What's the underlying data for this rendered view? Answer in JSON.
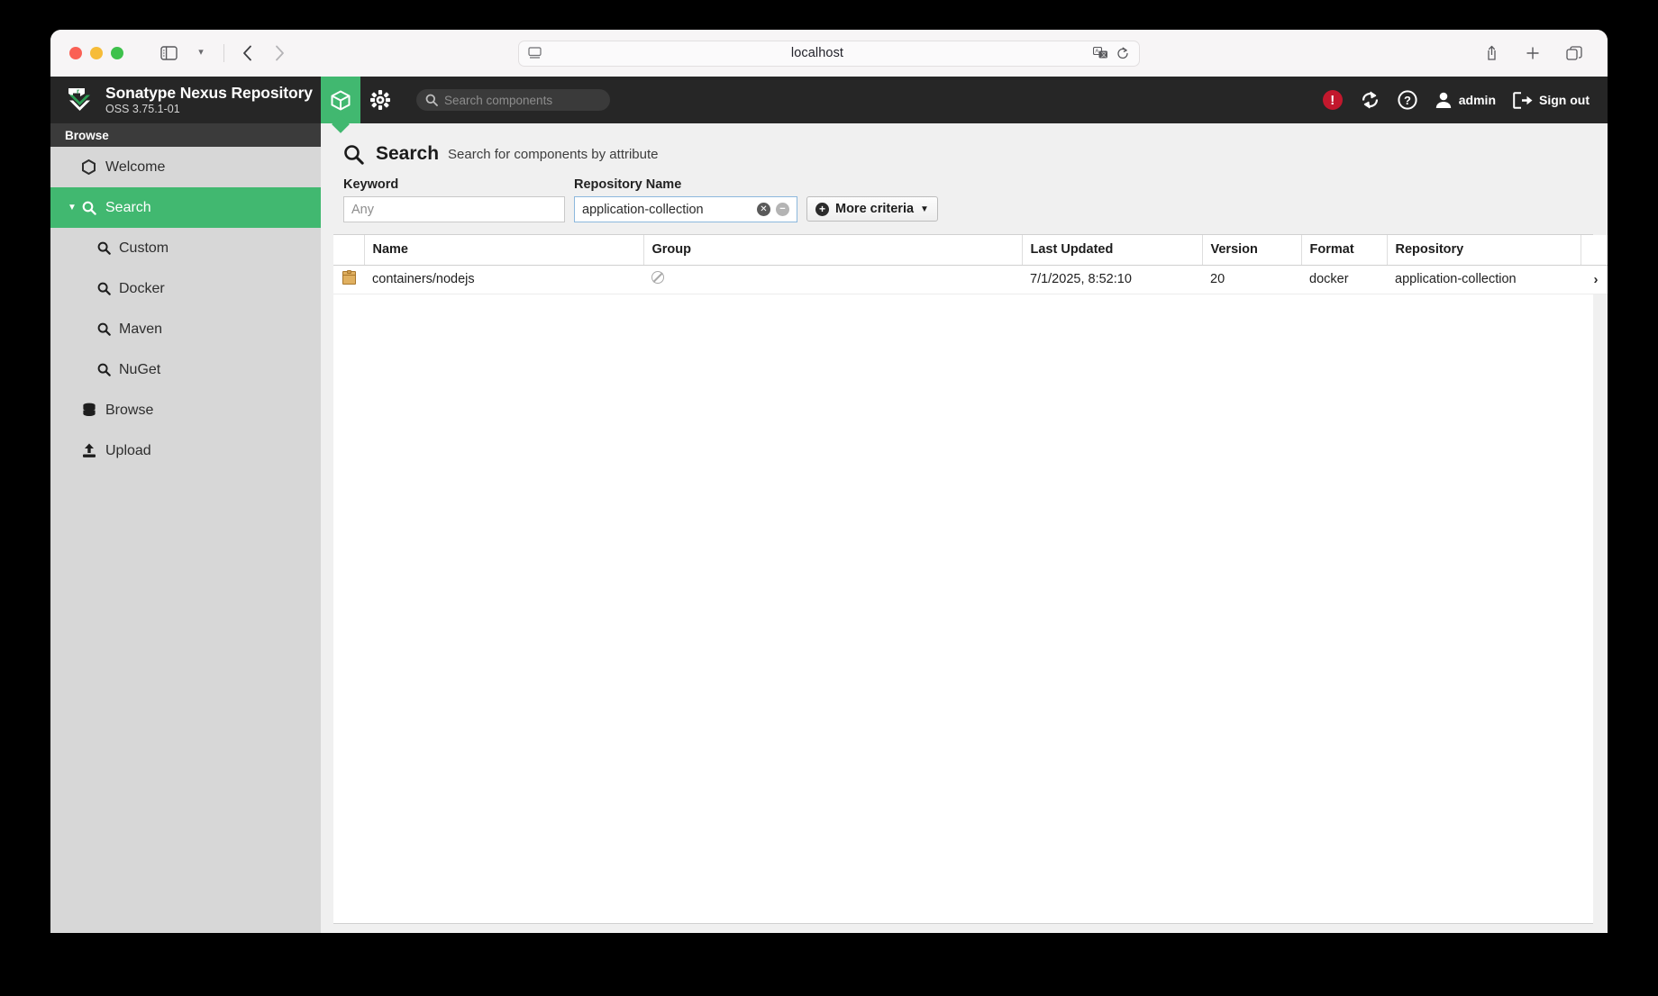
{
  "browser": {
    "url": "localhost",
    "icons": {
      "sidebar_toggle": "sidebar-toggle-icon",
      "tab_overview": "tab-overview-icon",
      "back": "back-icon",
      "forward": "forward-icon",
      "reader": "reader-view-icon",
      "translate": "translate-icon",
      "reload": "reload-icon",
      "share": "share-icon",
      "new_tab": "plus-icon"
    }
  },
  "header": {
    "brand_title": "Sonatype Nexus Repository",
    "brand_version": "OSS 3.75.1-01",
    "tabs": [
      {
        "name": "browse-tab",
        "icon": "box-icon",
        "active": true
      },
      {
        "name": "admin-tab",
        "icon": "gear-icon",
        "active": false
      }
    ],
    "search_placeholder": "Search components",
    "search_value": "",
    "alert_symbol": "!",
    "refresh_label": "refresh-icon",
    "help_label": "help-icon",
    "user": "admin",
    "sign_out": "Sign out"
  },
  "sidebar": {
    "title": "Browse",
    "items": [
      {
        "label": "Welcome",
        "icon": "hexagon-icon",
        "level": 0,
        "active": false
      },
      {
        "label": "Search",
        "icon": "search-icon",
        "level": 0,
        "active": true,
        "expanded": true
      },
      {
        "label": "Custom",
        "icon": "search-icon",
        "level": 1,
        "active": false
      },
      {
        "label": "Docker",
        "icon": "search-icon",
        "level": 1,
        "active": false
      },
      {
        "label": "Maven",
        "icon": "search-icon",
        "level": 1,
        "active": false
      },
      {
        "label": "NuGet",
        "icon": "search-icon",
        "level": 1,
        "active": false
      },
      {
        "label": "Browse",
        "icon": "database-icon",
        "level": 0,
        "active": false
      },
      {
        "label": "Upload",
        "icon": "upload-icon",
        "level": 0,
        "active": false
      }
    ]
  },
  "main": {
    "page_title": "Search",
    "page_subtitle": "Search for components by attribute",
    "filters": {
      "keyword_label": "Keyword",
      "keyword_placeholder": "Any",
      "keyword_value": "",
      "repository_label": "Repository Name",
      "repository_value": "application-collection",
      "more_criteria_label": "More criteria"
    },
    "table": {
      "columns": [
        "Name",
        "Group",
        "Last Updated",
        "Version",
        "Format",
        "Repository"
      ],
      "rows": [
        {
          "icon": "package-icon",
          "name": "containers/nodejs",
          "group": "",
          "last_updated": "7/1/2025, 8:52:10",
          "version": "20",
          "format": "docker",
          "repository": "application-collection"
        }
      ]
    }
  },
  "colors": {
    "accent_green": "#41b870",
    "header_dark": "#262626",
    "sidebar_bg": "#d7d7d7",
    "alert_red": "#c2182d"
  }
}
